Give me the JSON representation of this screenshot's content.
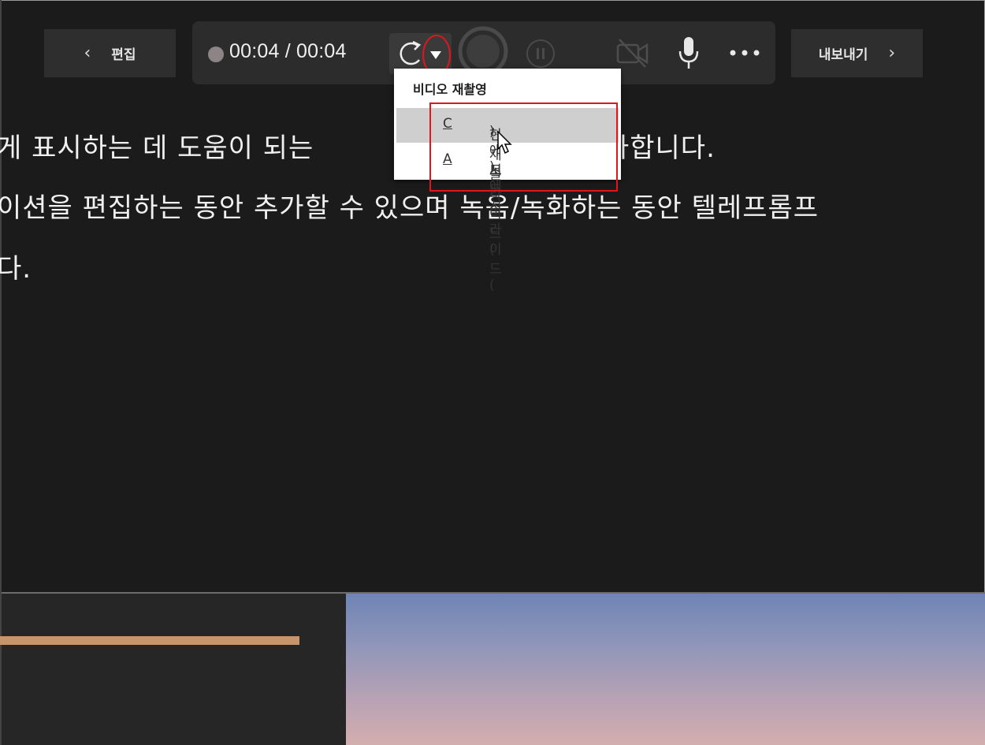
{
  "toolbar": {
    "edit_label": "편집",
    "export_label": "내보내기",
    "timecode": "00:04 / 00:04"
  },
  "menu": {
    "title": "비디오 재촬영",
    "item_current_prefix": "현재 슬라이드(",
    "item_current_key": "C",
    "item_current_suffix": ")에서",
    "item_all_prefix": "모든 슬라이드(",
    "item_all_key": "A",
    "item_all_suffix": ")에서"
  },
  "notes": {
    "line1a": "게 표시하는 데 도움이 되는",
    "line1b": "트를 추가합니다.",
    "line2": "이션을 편집하는 동안 추가할 수 있으며 녹음/녹화하는 동안 텔레프롬프",
    "line3": "다."
  },
  "icons": {
    "back": "chevron-left-icon",
    "forward": "chevron-right-icon",
    "retake": "retake-icon",
    "dropdown": "caret-down-icon",
    "record": "record-icon",
    "pause": "pause-icon",
    "camera": "camera-off-icon",
    "mic": "microphone-icon",
    "more": "more-options-icon",
    "cursor": "mouse-pointer-icon"
  },
  "colors": {
    "annotation_red": "#e0161c",
    "accent_orange": "#c8956a"
  }
}
